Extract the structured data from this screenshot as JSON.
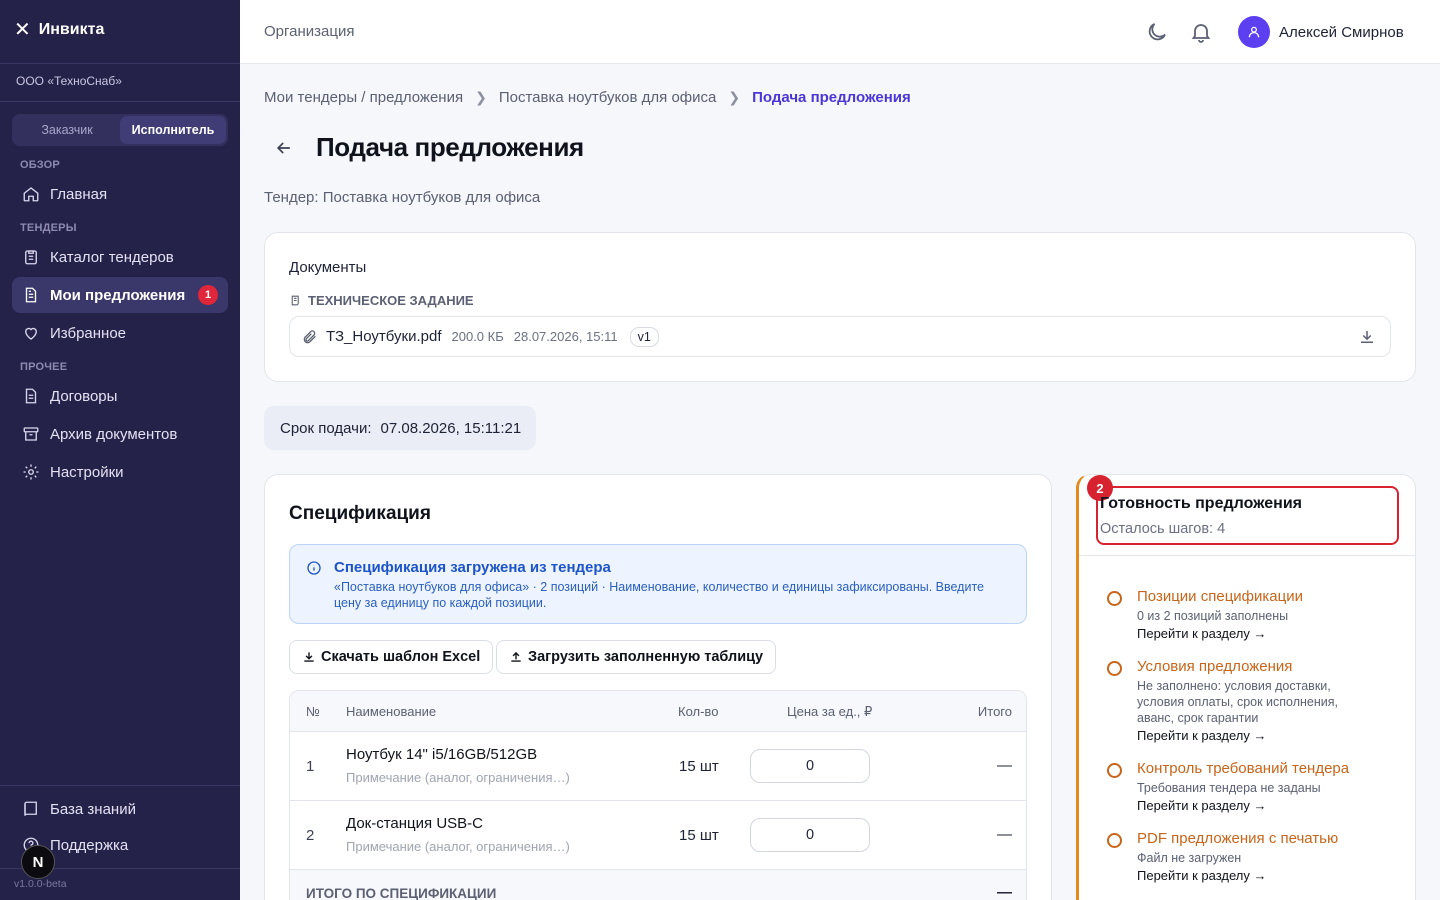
{
  "brand": {
    "name": "Инвикта"
  },
  "sidebar": {
    "org": "ООО «ТехноСнаб»",
    "roles": [
      "Заказчик",
      "Исполнитель"
    ],
    "sections": [
      "ОБЗОР",
      "ТЕНДЕРЫ",
      "ПРОЧЕЕ"
    ],
    "items": [
      {
        "label": "Главная",
        "icon": "home-icon"
      },
      {
        "label": "Каталог тендеров",
        "icon": "clipboard-icon"
      },
      {
        "label": "Мои предложения",
        "icon": "document-icon",
        "badge": "1"
      },
      {
        "label": "Избранное",
        "icon": "heart-icon"
      },
      {
        "label": "Договоры",
        "icon": "document-icon"
      },
      {
        "label": "Архив документов",
        "icon": "archive-icon"
      },
      {
        "label": "Настройки",
        "icon": "gear-icon"
      }
    ],
    "bottom": [
      {
        "label": "База знаний",
        "icon": "book-icon"
      },
      {
        "label": "Поддержка",
        "icon": "help-icon"
      }
    ],
    "version": "v1.0.0-beta",
    "dev_badge": "N"
  },
  "header": {
    "title": "Организация",
    "user": "Алексей Смирнов"
  },
  "breadcrumbs": [
    "Мои тендеры / предложения",
    "Поставка ноутбуков для офиса",
    "Подача предложения"
  ],
  "page": {
    "title": "Подача предложения",
    "subtitle": "Тендер: Поставка ноутбуков для офиса"
  },
  "documents": {
    "label": "Документы",
    "section": "ТЕХНИЧЕСКОЕ ЗАДАНИЕ",
    "file": {
      "name": "ТЗ_Ноутбуки.pdf",
      "size": "200.0 КБ",
      "date": "28.07.2026, 15:11",
      "version": "v1"
    }
  },
  "deadline": {
    "label": "Срок подачи:",
    "value": "07.08.2026, 15:11:21"
  },
  "spec": {
    "title": "Спецификация",
    "info_title": "Спецификация загружена из тендера",
    "info_text": "«Поставка ноутбуков для офиса» · 2 позиций · Наименование, количество и единицы зафиксированы. Введите цену за единицу по каждой позиции.",
    "download_btn": "Скачать шаблон Excel",
    "upload_btn": "Загрузить заполненную таблицу",
    "columns": [
      "№",
      "Наименование",
      "Кол-во",
      "Цена за ед., ₽",
      "Итого"
    ],
    "rows": [
      {
        "num": "1",
        "name": "Ноутбук 14\" i5/16GB/512GB",
        "note": "Примечание (аналог, ограничения…)",
        "qty": "15 шт",
        "price": "0",
        "total": "—"
      },
      {
        "num": "2",
        "name": "Док-станция USB-C",
        "note": "Примечание (аналог, ограничения…)",
        "qty": "15 шт",
        "price": "0",
        "total": "—"
      }
    ],
    "total_label": "ИТОГО ПО СПЕЦИФИКАЦИИ",
    "total_value": "—"
  },
  "readiness": {
    "badge": "2",
    "title": "Готовность предложения",
    "subtitle": "Осталось шагов: 4",
    "steps": [
      {
        "title": "Позиции спецификации",
        "desc": "0 из 2 позиций заполнены",
        "link": "Перейти к разделу →"
      },
      {
        "title": "Условия предложения",
        "desc": "Не заполнено: условия доставки, условия оплаты, срок исполнения, аванс, срок гарантии",
        "link": "Перейти к разделу →"
      },
      {
        "title": "Контроль требований тендера",
        "desc": "Требования тендера не заданы",
        "link": "Перейти к разделу →"
      },
      {
        "title": "PDF предложения с печатью",
        "desc": "Файл не загружен",
        "link": "Перейти к разделу →"
      }
    ]
  },
  "colors": {
    "sidebar": "#25224a",
    "accent": "#4b36d8",
    "warning": "#c8651a",
    "danger": "#d7232f"
  }
}
